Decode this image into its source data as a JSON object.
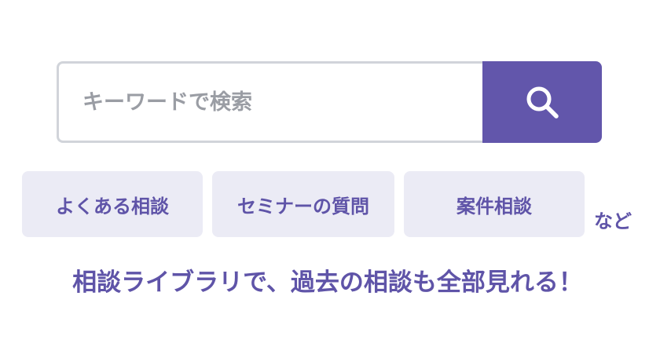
{
  "search": {
    "placeholder": "キーワードで検索",
    "button_icon": "search-icon",
    "button_color": "#6256ab"
  },
  "tags": {
    "items": [
      {
        "label": "よくある相談"
      },
      {
        "label": "セミナーの質問"
      },
      {
        "label": "案件相談"
      }
    ],
    "suffix": "など"
  },
  "tagline": "相談ライブラリで、過去の相談も全部見れる！",
  "colors": {
    "accent": "#6256ab",
    "tag_background": "#ebebf5",
    "input_border": "#d1d4da",
    "placeholder": "#9a9da4"
  }
}
